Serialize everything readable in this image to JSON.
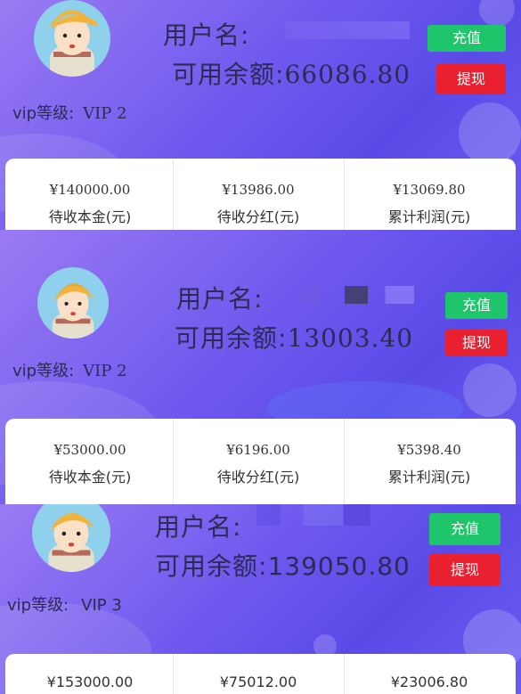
{
  "panels": [
    {
      "username_label": "用户名:",
      "balance_label": "可用余额:",
      "balance_value": "66086.80",
      "vip_label": "vip等级:",
      "vip_value": "VIP 2",
      "recharge_label": "充值",
      "withdraw_label": "提现",
      "stats": [
        {
          "amount": "¥140000.00",
          "caption": "待收本金(元)"
        },
        {
          "amount": "¥13986.00",
          "caption": "待收分红(元)"
        },
        {
          "amount": "¥13069.80",
          "caption": "累计利润(元)"
        }
      ]
    },
    {
      "username_label": "用户名:",
      "balance_label": "可用余额:",
      "balance_value": "13003.40",
      "vip_label": "vip等级:",
      "vip_value": "VIP 2",
      "recharge_label": "充值",
      "withdraw_label": "提现",
      "stats": [
        {
          "amount": "¥53000.00",
          "caption": "待收本金(元)"
        },
        {
          "amount": "¥6196.00",
          "caption": "待收分红(元)"
        },
        {
          "amount": "¥5398.40",
          "caption": "累计利润(元)"
        }
      ]
    },
    {
      "username_label": "用户名:",
      "balance_label": "可用余额:",
      "balance_value": "139050.80",
      "vip_label": "vip等级:",
      "vip_value": "VIP 3",
      "recharge_label": "充值",
      "withdraw_label": "提现",
      "stats": [
        {
          "amount": "¥153000.00",
          "caption": ""
        },
        {
          "amount": "¥75012.00",
          "caption": ""
        },
        {
          "amount": "¥23006.80",
          "caption": ""
        }
      ]
    }
  ],
  "colors": {
    "recharge": "#1fc56b",
    "withdraw": "#e8202f",
    "background": "#6f58ee"
  },
  "icons": {
    "avatar": "cartoon-boy-avatar-icon"
  }
}
